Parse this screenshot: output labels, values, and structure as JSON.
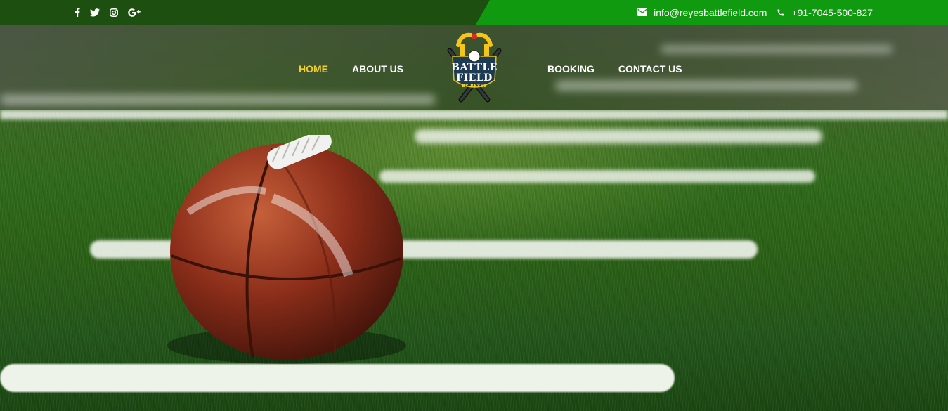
{
  "topbar": {
    "social_icons": [
      "facebook-icon",
      "twitter-icon",
      "instagram-icon",
      "google-plus-icon"
    ],
    "email": "info@reyesbattlefield.com",
    "phone": "+91-7045-500-827",
    "colors": {
      "dark_green": "#1c4f10",
      "bright_green": "#0f9a10"
    }
  },
  "nav": {
    "left": [
      {
        "label": "HOME",
        "active": true
      },
      {
        "label": "ABOUT US",
        "active": false
      }
    ],
    "right": [
      {
        "label": "BOOKING",
        "active": false
      },
      {
        "label": "CONTACT US",
        "active": false
      }
    ],
    "active_color": "#f3d12b"
  },
  "logo": {
    "line1": "BATTLE",
    "line2": "FIELD",
    "line3": "BY REYES"
  },
  "hero": {
    "image": "american-football-on-turf"
  }
}
